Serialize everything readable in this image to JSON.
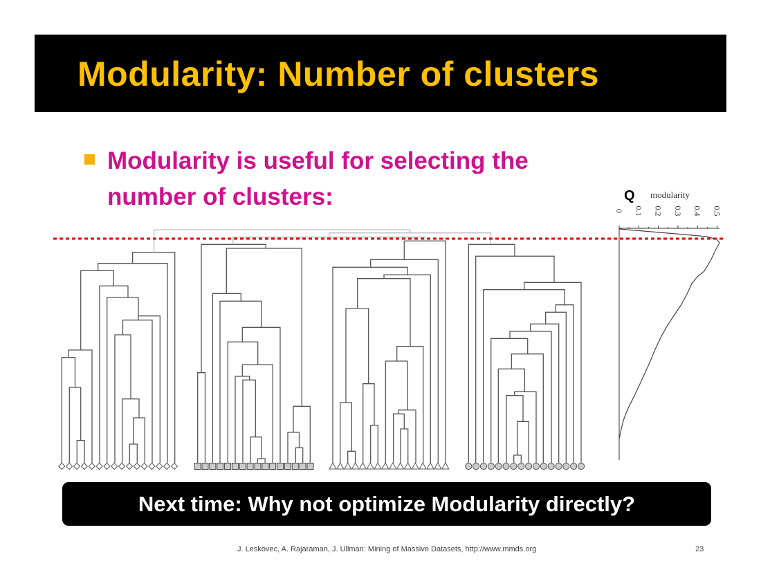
{
  "slide": {
    "title": "Modularity: Number of clusters",
    "bullet": "Modularity is useful for selecting the number of clusters:",
    "callout": "Next time: Why not optimize Modularity directly?",
    "footer": "J. Leskovec, A. Rajaraman, J. Ullman: Mining of Massive Datasets, http://www.mmds.org",
    "page_number": "23"
  },
  "modularity_plot": {
    "q_label": "Q",
    "axis_label": "modularity",
    "ticks": [
      "0",
      "0.1",
      "0.2",
      "0.3",
      "0.4",
      "0.5"
    ]
  },
  "dendrogram": {
    "clusters": [
      {
        "marker": "diamond",
        "leaves": 16
      },
      {
        "marker": "square",
        "leaves": 16
      },
      {
        "marker": "triangle",
        "leaves": 16
      },
      {
        "marker": "circle",
        "leaves": 16
      }
    ]
  },
  "colors": {
    "title": "#FFC000",
    "bullet_text": "#D0108C",
    "bullet_marker": "#F9B000",
    "cut_line": "#E00000"
  }
}
